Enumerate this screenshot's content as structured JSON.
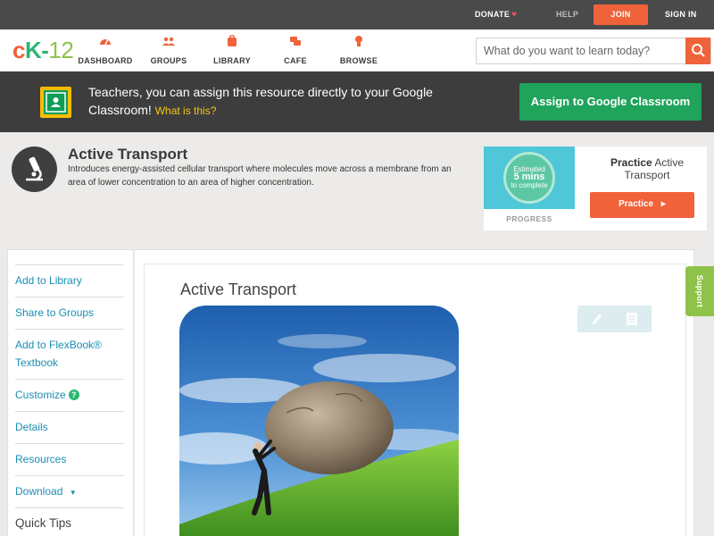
{
  "topbar": {
    "donate": "DONATE",
    "help": "HELP",
    "join": "JOIN",
    "signin": "SIGN IN"
  },
  "logo": {
    "text": "CK-12"
  },
  "nav": {
    "items": [
      {
        "label": "DASHBOARD",
        "icon": "dashboard-gauge-icon"
      },
      {
        "label": "GROUPS",
        "icon": "groups-people-icon"
      },
      {
        "label": "LIBRARY",
        "icon": "library-bag-icon"
      },
      {
        "label": "CAFE",
        "icon": "cafe-chat-icon"
      },
      {
        "label": "BROWSE",
        "icon": "browse-bulb-icon"
      }
    ]
  },
  "search": {
    "placeholder": "What do you want to learn today?",
    "icon": "search-icon"
  },
  "banner": {
    "text": "Teachers, you can assign this resource directly to your Google Classroom!",
    "link": "What is this?",
    "button": "Assign to Google Classroom"
  },
  "resource": {
    "title": "Active Transport",
    "description": "Introduces energy-assisted cellular transport where molecules move across a membrane from an area of lower concentration to an area of higher concentration.",
    "icon": "microscope-icon"
  },
  "practice": {
    "estimate_line1": "Estimated",
    "estimate_line2": "5 mins",
    "estimate_line3": "to complete",
    "progress_label": "PROGRESS",
    "title_bold": "Practice",
    "title_rest": "Active Transport",
    "button": "Practice"
  },
  "sidebar": {
    "items": [
      {
        "label": "Add to Library"
      },
      {
        "label": "Share to Groups"
      },
      {
        "label": "Add to FlexBook® Textbook"
      },
      {
        "label": "Customize"
      },
      {
        "label": "Details"
      },
      {
        "label": "Resources"
      },
      {
        "label": "Download"
      },
      {
        "label": "Quick Tips"
      }
    ]
  },
  "content": {
    "title": "Active Transport",
    "image_alt": "man pushing boulder up hill"
  },
  "support": {
    "label": "Support"
  },
  "colors": {
    "accent_orange": "#f0623a",
    "accent_green": "#2bb673",
    "link_blue": "#1a8eb4",
    "support_green": "#8fc249"
  }
}
